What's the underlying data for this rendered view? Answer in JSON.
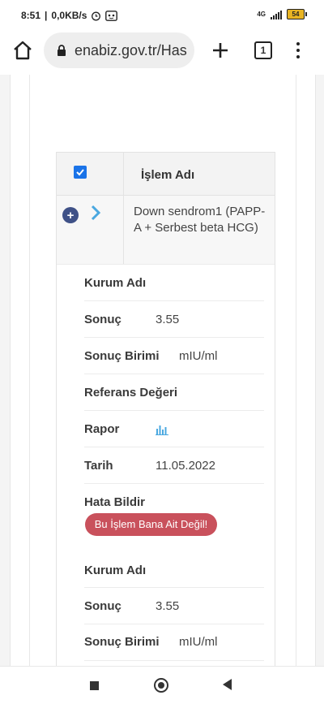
{
  "status_bar": {
    "time": "8:51",
    "speed": "0,0KB/s",
    "battery_level": "54",
    "network": "4G"
  },
  "browser": {
    "url": "enabiz.gov.tr/Has",
    "tab_count": "1"
  },
  "table": {
    "header_label": "İşlem Adı",
    "row_name": "Down sendrom1 (PAPP-A + Serbest beta HCG)",
    "details": [
      {
        "key": "Kurum Adı",
        "value": ""
      },
      {
        "key": "Sonuç",
        "value": "3.55"
      },
      {
        "key": "Sonuç Birimi",
        "value": "mIU/ml"
      },
      {
        "key": "Referans Değeri",
        "value": ""
      },
      {
        "key": "Rapor",
        "value": ""
      },
      {
        "key": "Tarih",
        "value": "11.05.2022"
      },
      {
        "key": "Hata Bildir",
        "value": ""
      }
    ],
    "error_button": "Bu İşlem Bana Ait Değil!",
    "details2": [
      {
        "key": "Kurum Adı",
        "value": ""
      },
      {
        "key": "Sonuç",
        "value": "3.55"
      },
      {
        "key": "Sonuç Birimi",
        "value": "mIU/ml"
      }
    ]
  },
  "colors": {
    "checkbox": "#1a73e8",
    "expand_button": "#3f5187",
    "chevron": "#4aa8e0",
    "error_button": "#c9515c",
    "report_icon": "#4aa8e0"
  },
  "icons": [
    "home-icon",
    "lock-icon",
    "plus-icon",
    "tabs-icon",
    "menu-icon",
    "checkbox-icon",
    "expand-icon",
    "chevron-right-icon",
    "bar-chart-icon",
    "recents-icon",
    "home-nav-icon",
    "back-icon"
  ]
}
